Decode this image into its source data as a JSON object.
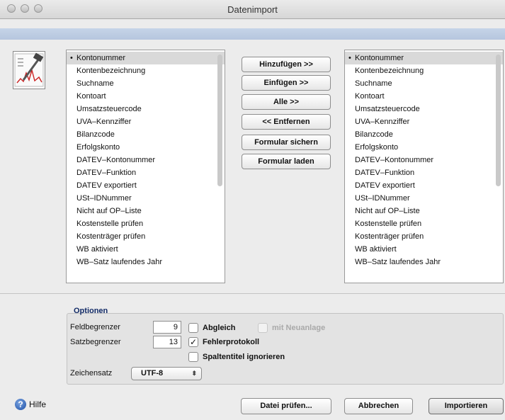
{
  "window": {
    "title": "Datenimport"
  },
  "lists": {
    "available": [
      "Kontonummer",
      "Kontenbezeichnung",
      "Suchname",
      "Kontoart",
      "Umsatzsteuercode",
      "UVA–Kennziffer",
      "Bilanzcode",
      "Erfolgskonto",
      "DATEV–Kontonummer",
      "DATEV–Funktion",
      "DATEV exportiert",
      "USt–IDNummer",
      "Nicht auf OP–Liste",
      "Kostenstelle prüfen",
      "Kostenträger prüfen",
      "WB aktiviert",
      "WB–Satz laufendes Jahr"
    ],
    "selected": [
      "Kontonummer",
      "Kontenbezeichnung",
      "Suchname",
      "Kontoart",
      "Umsatzsteuercode",
      "UVA–Kennziffer",
      "Bilanzcode",
      "Erfolgskonto",
      "DATEV–Kontonummer",
      "DATEV–Funktion",
      "DATEV exportiert",
      "USt–IDNummer",
      "Nicht auf OP–Liste",
      "Kostenstelle prüfen",
      "Kostenträger prüfen",
      "WB aktiviert",
      "WB–Satz laufendes Jahr"
    ],
    "bullet": "•"
  },
  "actions": {
    "add": "Hinzufügen >>",
    "insert": "Einfügen >>",
    "all": "Alle >>",
    "remove": "<< Entfernen",
    "save_form": "Formular sichern",
    "load_form": "Formular laden"
  },
  "options": {
    "title": "Optionen",
    "field_delimiter_label": "Feldbegrenzer",
    "field_delimiter_value": "9",
    "record_delimiter_label": "Satzbegrenzer",
    "record_delimiter_value": "13",
    "abgleich": {
      "label": "Abgleich",
      "checked": false
    },
    "neuanlage": {
      "label": "mit Neuanlage",
      "checked": false,
      "disabled": true
    },
    "fehlerprotokoll": {
      "label": "Fehlerprotokoll",
      "checked": true
    },
    "spaltentitel": {
      "label": "Spaltentitel ignorieren",
      "checked": false
    },
    "charset_label": "Zeichensatz",
    "charset_value": "UTF-8",
    "check_mark": "✓",
    "select_arrows": "⬍"
  },
  "footer": {
    "help": "Hilfe",
    "help_glyph": "?",
    "check_file": "Datei prüfen...",
    "cancel": "Abbrechen",
    "import": "Importieren"
  },
  "colors": {
    "accent_band": "#b9c8df",
    "options_title": "#112a66"
  }
}
